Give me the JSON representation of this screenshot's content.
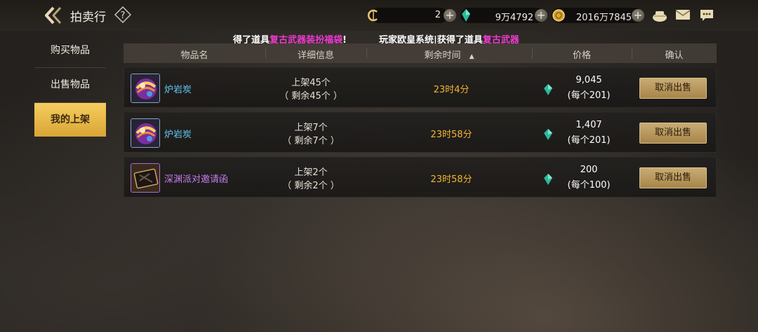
{
  "header": {
    "title": "拍卖行",
    "currencies": [
      {
        "name": "coupon",
        "value": "2"
      },
      {
        "name": "gem",
        "value": "9万4792"
      },
      {
        "name": "gold",
        "value": "2016万7845"
      }
    ]
  },
  "ticker": {
    "part1": "得了道具",
    "part1_hl": "复古武器装扮福袋",
    "part1_end": "!",
    "part2": "玩家欧皇系统|获得了道具",
    "part2_hl": "复古武器"
  },
  "sidebar": {
    "items": [
      {
        "label": "购买物品",
        "active": false
      },
      {
        "label": "出售物品",
        "active": false
      },
      {
        "label": "我的上架",
        "active": true
      }
    ]
  },
  "table": {
    "headers": [
      "物品名",
      "详细信息",
      "剩余时间",
      "价格",
      "确认"
    ],
    "sort_indicator": "▲",
    "rows": [
      {
        "name": "炉岩炭",
        "name_color": "#5fc9f5",
        "detail_listed": "上架45个",
        "detail_left": "（ 剩余45个 ）",
        "time": "23时4分",
        "price": "9,045",
        "unit_price": "(每个201)",
        "action": "取消出售",
        "icon": "orb"
      },
      {
        "name": "炉岩炭",
        "name_color": "#5fc9f5",
        "detail_listed": "上架7个",
        "detail_left": "（ 剩余7个 ）",
        "time": "23时58分",
        "price": "1,407",
        "unit_price": "(每个201)",
        "action": "取消出售",
        "icon": "orb"
      },
      {
        "name": "深渊派对邀请函",
        "name_color": "#c77bf0",
        "detail_listed": "上架2个",
        "detail_left": "（ 剩余2个 ）",
        "time": "23时58分",
        "price": "200",
        "unit_price": "(每个100)",
        "action": "取消出售",
        "icon": "card"
      }
    ]
  }
}
